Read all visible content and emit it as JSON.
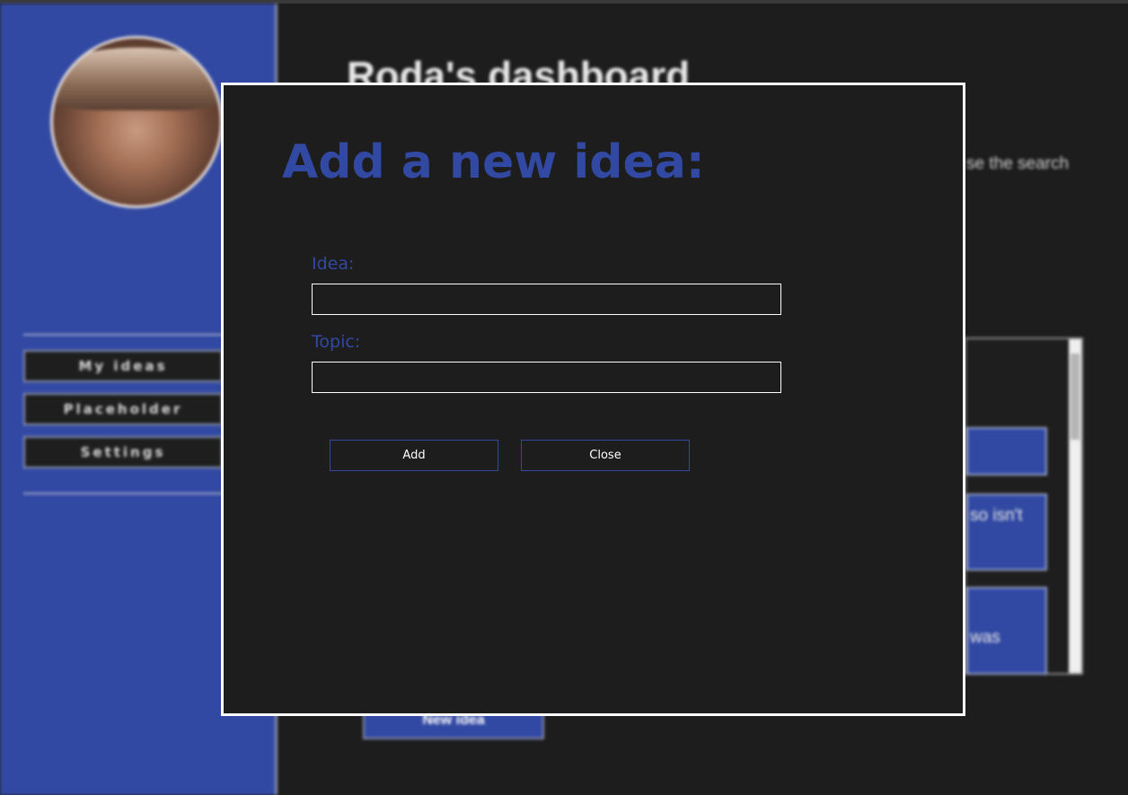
{
  "dashboard": {
    "title": "Roda's dashboard",
    "description_fragment": "se the search",
    "new_idea_label": "New idea",
    "cards": [
      {
        "text": ""
      },
      {
        "text": "so isn't"
      },
      {
        "text": "was"
      }
    ]
  },
  "sidebar": {
    "items": [
      {
        "label": "My ideas"
      },
      {
        "label": "Placeholder"
      },
      {
        "label": "Settings"
      }
    ]
  },
  "modal": {
    "title": "Add a new idea:",
    "idea_label": "Idea:",
    "idea_value": "",
    "topic_label": "Topic:",
    "topic_value": "",
    "add_label": "Add",
    "close_label": "Close"
  },
  "colors": {
    "accent": "#3249a3",
    "background": "#1d1d1d",
    "border": "#ffffff"
  }
}
